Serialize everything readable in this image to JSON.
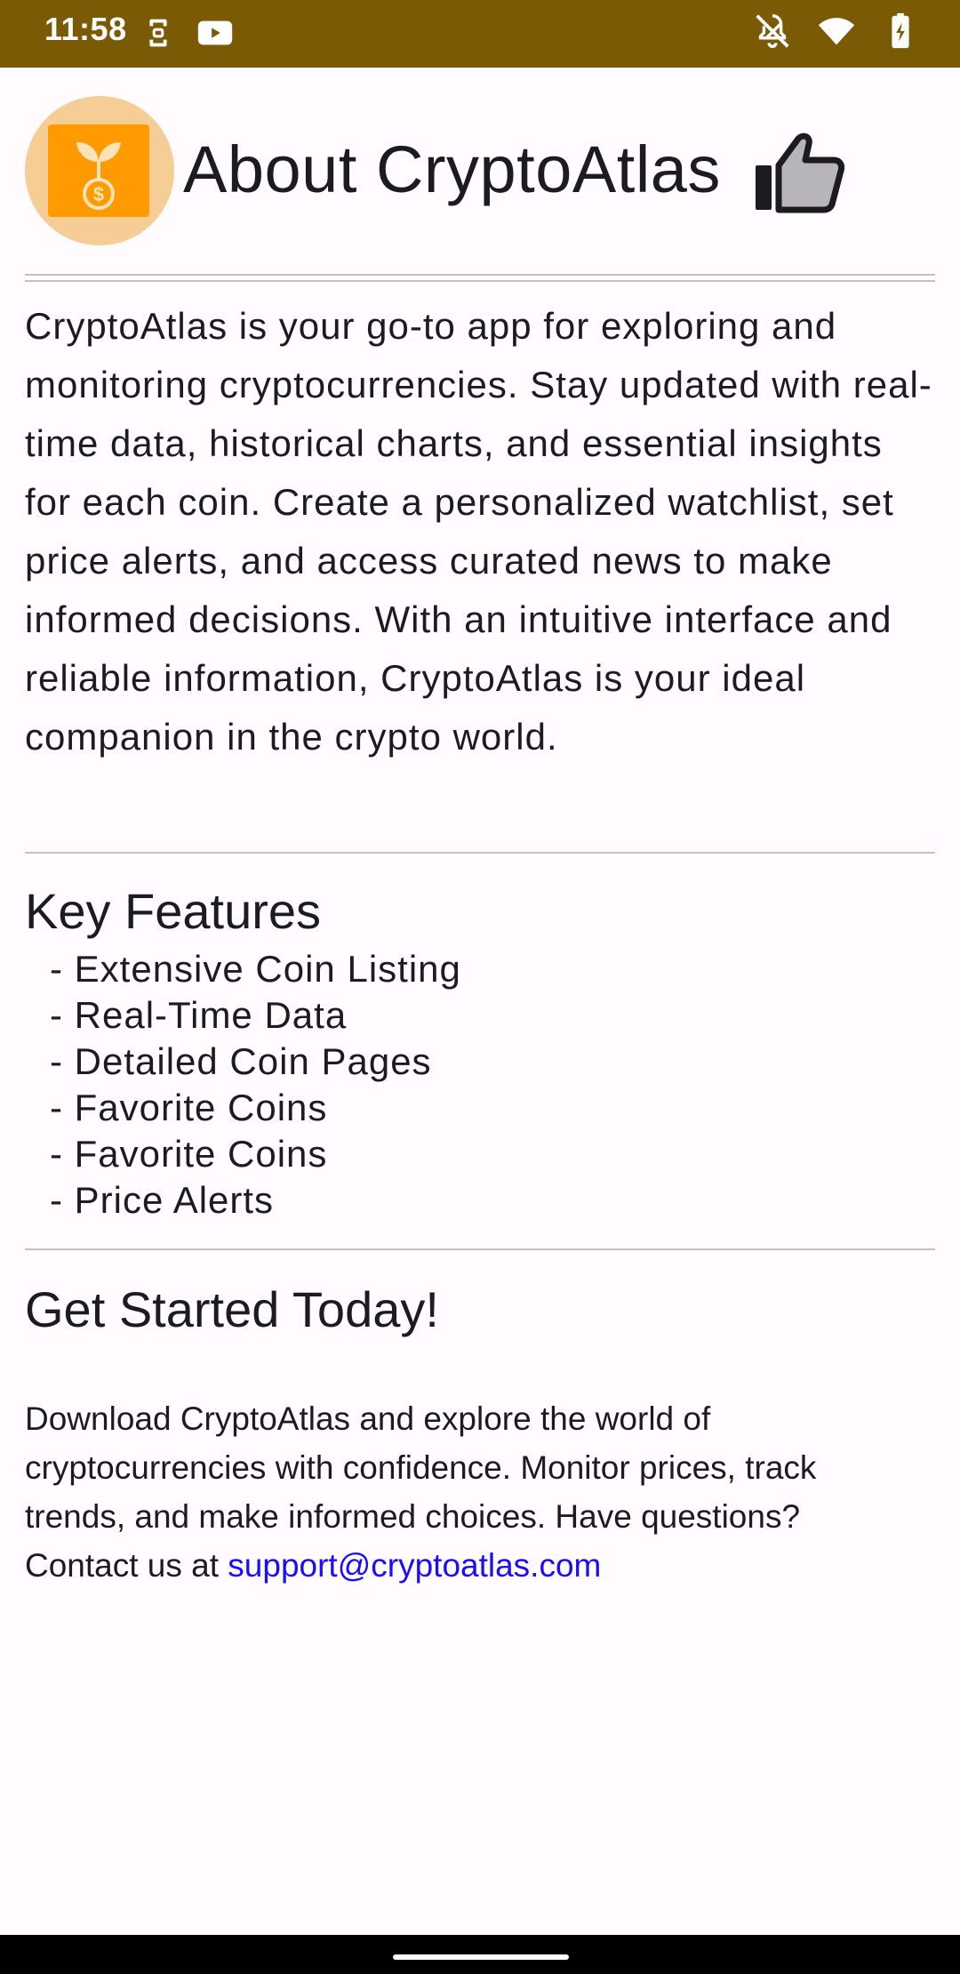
{
  "status_bar": {
    "time": "11:58",
    "left_icons": [
      "screenshot-icon",
      "youtube-icon"
    ],
    "right_icons": [
      "notifications-off-icon",
      "wifi-icon",
      "battery-charging-icon"
    ],
    "background": "#7b5a06"
  },
  "header": {
    "title": "About CryptoAtlas",
    "logo": "plant-coin-logo",
    "title_icon": "thumbs-up-icon"
  },
  "about": {
    "text": "CryptoAtlas is your go-to app for exploring and monitoring cryptocurrencies. Stay updated with real-time data, historical charts, and essential insights for each coin. Create a personalized watchlist, set price alerts, and access curated news to make informed decisions. With an intuitive interface and reliable information, CryptoAtlas is your ideal companion in the crypto world."
  },
  "features": {
    "title": "Key Features",
    "items": [
      "- Extensive Coin Listing",
      "- Real-Time Data",
      "- Detailed Coin Pages",
      "- Favorite Coins",
      "- Favorite Coins",
      "- Price Alerts"
    ]
  },
  "get_started": {
    "title": "Get Started Today!",
    "text": "Download CryptoAtlas and explore the world of cryptocurrencies with confidence. Monitor prices, track trends, and make informed choices. Have questions? Contact us at ",
    "email": "support@cryptoatlas.com"
  },
  "colors": {
    "accent": "#ff9a00",
    "logo_bg": "#f5cd95",
    "link": "#1a0dff",
    "divider": "#c9bfb6",
    "page_bg": "#fffbfe"
  }
}
